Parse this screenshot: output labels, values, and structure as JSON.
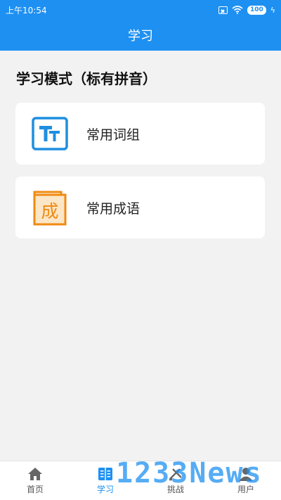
{
  "status": {
    "time": "上午10:54",
    "battery": "100",
    "bolt": "ϟ"
  },
  "header": {
    "title": "学习"
  },
  "section": {
    "heading": "学习模式（标有拼音）"
  },
  "cards": [
    {
      "label": "常用词组",
      "icon": "text-size-icon",
      "icon_text": "Tт",
      "color": "#1e8fe0"
    },
    {
      "label": "常用成语",
      "icon": "idiom-folder-icon",
      "icon_text": "成",
      "color": "#f08a10"
    }
  ],
  "tabs": [
    {
      "label": "首页",
      "icon": "home-icon",
      "active": false
    },
    {
      "label": "学习",
      "icon": "book-icon",
      "active": true
    },
    {
      "label": "挑战",
      "icon": "challenge-icon",
      "active": false
    },
    {
      "label": "用户",
      "icon": "user-icon",
      "active": false
    }
  ],
  "watermark": "1233News",
  "colors": {
    "primary": "#1e90f2",
    "background": "#f2f2f2"
  }
}
